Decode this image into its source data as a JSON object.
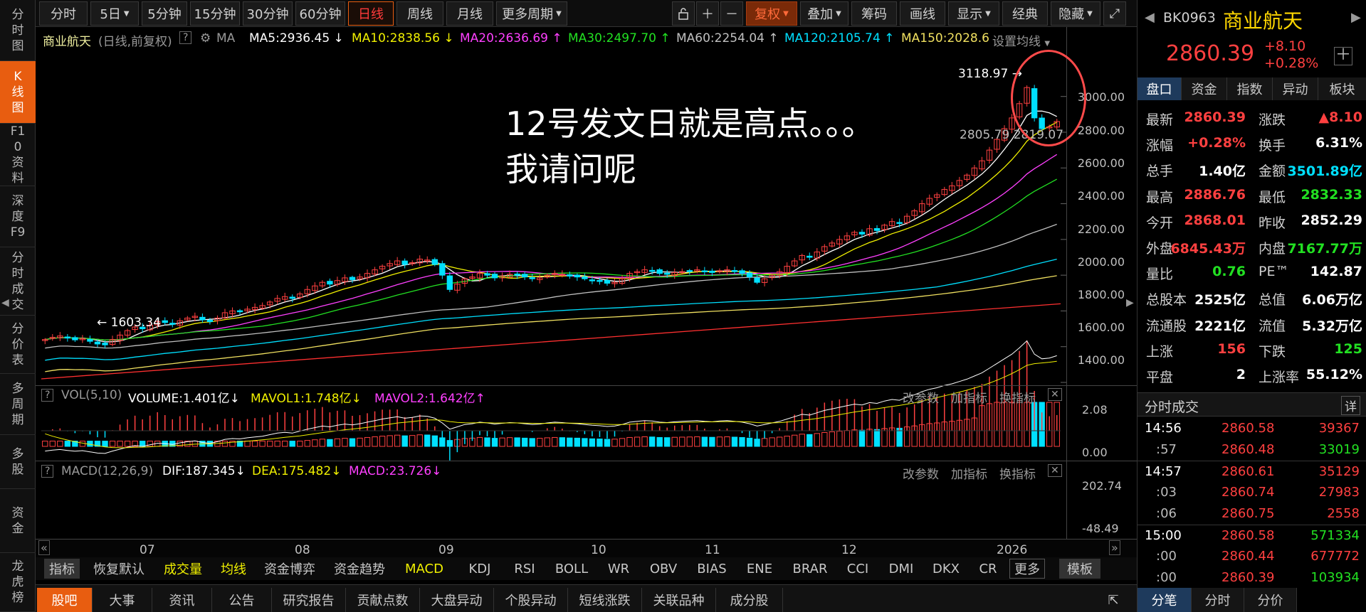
{
  "left_tabs": [
    {
      "label": "分时图",
      "active": false
    },
    {
      "label": "K线图",
      "active": true
    },
    {
      "label": "F10资料",
      "active": false
    },
    {
      "label": "深度F9",
      "active": false
    },
    {
      "label": "分时成交",
      "active": false
    },
    {
      "label": "分价表",
      "active": false
    },
    {
      "label": "多周期",
      "active": false
    },
    {
      "label": "多股",
      "active": false
    },
    {
      "label": "资金",
      "active": false
    },
    {
      "label": "龙虎榜",
      "active": false
    }
  ],
  "toolbar": {
    "periods": [
      "分时",
      "5日",
      "5分钟",
      "15分钟",
      "30分钟",
      "60分钟",
      "日线",
      "周线",
      "月线",
      "更多周期"
    ],
    "active_period": "日线",
    "fuquan": "复权",
    "diejia": "叠加",
    "chouma": "筹码",
    "huaxian": "画线",
    "xianshi": "显示",
    "jingdian": "经典",
    "yincang": "隐藏"
  },
  "ma_bar": {
    "name": "商业航天",
    "mode": "(日线,前复权)",
    "q": "?",
    "ma": "MA",
    "ma5": "MA5:2936.45",
    "ma10": "MA10:2838.56",
    "ma20": "MA20:2636.69",
    "ma30": "MA30:2497.70",
    "ma60": "MA60:2254.04",
    "ma120": "MA120:2105.74",
    "ma150": "MA150:2028.6",
    "settings": "设置均线"
  },
  "price_axis": [
    "3000.00",
    "2800.00",
    "2600.00",
    "2400.00",
    "2200.00",
    "2000.00",
    "1800.00",
    "1600.00",
    "1400.00"
  ],
  "annotations": {
    "high": "3118.97",
    "low": "1603.34",
    "last_left": "2805.79",
    "last_right": "2819.07"
  },
  "overlay_text": {
    "line1": "12号发文日就是高点。。。",
    "line2": "我请问呢"
  },
  "vol": {
    "q": "?",
    "title": "VOL(5,10)",
    "volume": "VOLUME:1.401亿",
    "mavol1": "MAVOL1:1.748亿",
    "mavol2": "MAVOL2:1.642亿",
    "axis_top": "2.08",
    "axis_bottom": "0.00"
  },
  "macd": {
    "q": "?",
    "title": "MACD(12,26,9)",
    "dif": "DIF:187.345",
    "dea": "DEA:175.482",
    "macd": "MACD:23.726",
    "axis_top": "202.74",
    "axis_bottom": "-48.49"
  },
  "panel_buttons": {
    "param": "改参数",
    "add": "加指标",
    "swap": "换指标"
  },
  "x_axis": [
    "07",
    "08",
    "09",
    "10",
    "11",
    "12",
    "2026"
  ],
  "indicator_tabs": [
    "指标",
    "恢复默认",
    "成交量",
    "均线",
    "资金博弈",
    "资金趋势",
    "MACD",
    "KDJ",
    "RSI",
    "BOLL",
    "WR",
    "OBV",
    "BIAS",
    "ENE",
    "BRAR",
    "CCI",
    "DMI",
    "DKX",
    "CR",
    "更多",
    "模板"
  ],
  "bottom_tabs": [
    "股吧",
    "大事",
    "资讯",
    "公告",
    "研究报告",
    "贡献点数",
    "大盘异动",
    "个股异动",
    "短线涨跌",
    "关联品种",
    "成分股"
  ],
  "stock": {
    "code": "BK0963",
    "name": "商业航天",
    "price": "2860.39",
    "change": "+8.10",
    "pct": "+0.28%"
  },
  "right_tabs": [
    "盘口",
    "资金",
    "指数",
    "异动",
    "板块"
  ],
  "quote": [
    {
      "l1": "最新",
      "v1": "2860.39",
      "c1": "red",
      "l2": "涨跌",
      "v2": "▲8.10",
      "c2": "red"
    },
    {
      "l1": "涨幅",
      "v1": "+0.28%",
      "c1": "red",
      "l2": "换手",
      "v2": "6.31%",
      "c2": "white"
    },
    {
      "l1": "总手",
      "v1": "1.40亿",
      "c1": "white",
      "l2": "金额",
      "v2": "3501.89亿",
      "c2": "cyan"
    },
    {
      "l1": "最高",
      "v1": "2886.76",
      "c1": "red",
      "l2": "最低",
      "v2": "2832.33",
      "c2": "green"
    },
    {
      "l1": "今开",
      "v1": "2868.01",
      "c1": "red",
      "l2": "昨收",
      "v2": "2852.29",
      "c2": "white"
    },
    {
      "l1": "外盘",
      "v1": "6845.43万",
      "c1": "red",
      "l2": "内盘",
      "v2": "7167.77万",
      "c2": "green"
    },
    {
      "l1": "量比",
      "v1": "0.76",
      "c1": "green",
      "l2": "PE™",
      "v2": "142.87",
      "c2": "white"
    },
    {
      "l1": "总股本",
      "v1": "2525亿",
      "c1": "white",
      "l2": "总值",
      "v2": "6.06万亿",
      "c2": "white"
    },
    {
      "l1": "流通股",
      "v1": "2221亿",
      "c1": "white",
      "l2": "流值",
      "v2": "5.32万亿",
      "c2": "white"
    },
    {
      "l1": "上涨",
      "v1": "156",
      "c1": "red",
      "l2": "下跌",
      "v2": "125",
      "c2": "green"
    },
    {
      "l1": "平盘",
      "v1": "2",
      "c1": "white",
      "l2": "上涨率",
      "v2": "55.12%",
      "c2": "white"
    }
  ],
  "ticks_title": "分时成交",
  "ticks_detail": "详",
  "ticks": [
    {
      "time": "14:56",
      "price": "2860.58",
      "vol": "39367",
      "vc": "red"
    },
    {
      "time": ":57",
      "price": "2860.48",
      "vol": "33019",
      "vc": "green"
    },
    {
      "time": "14:57",
      "price": "2860.61",
      "vol": "35129",
      "vc": "red"
    },
    {
      "time": ":03",
      "price": "2860.74",
      "vol": "27983",
      "vc": "red"
    },
    {
      "time": ":06",
      "price": "2860.75",
      "vol": "2558",
      "vc": "red"
    },
    {
      "time": "15:00",
      "price": "2860.58",
      "vol": "571334",
      "vc": "green"
    },
    {
      "time": ":00",
      "price": "2860.44",
      "vol": "677772",
      "vc": "red"
    },
    {
      "time": ":00",
      "price": "2860.39",
      "vol": "103934",
      "vc": "green"
    }
  ],
  "right_bottom_tabs": [
    "分笔",
    "分时",
    "分价"
  ],
  "colors": {
    "accent": "#e85d10",
    "up": "#ff4040",
    "down": "#00e0ff",
    "ma5": "#ffffff",
    "ma10": "#f0f000",
    "ma20": "#ff40ff",
    "ma30": "#22e022",
    "ma60": "#c0c0c0",
    "ma120": "#00e0ff",
    "ma150": "#f0e060",
    "ma250": "#ff3030",
    "circle": "#ff4040"
  },
  "chart_data": {
    "type": "candlestick",
    "x_ticks": [
      "07",
      "08",
      "09",
      "10",
      "11",
      "12",
      "2026"
    ],
    "ylim": [
      1400,
      3150
    ],
    "close": [
      1640,
      1652,
      1660,
      1648,
      1638,
      1645,
      1630,
      1615,
      1610,
      1640,
      1665,
      1690,
      1710,
      1700,
      1720,
      1740,
      1735,
      1725,
      1745,
      1760,
      1770,
      1750,
      1740,
      1760,
      1790,
      1800,
      1795,
      1810,
      1820,
      1830,
      1850,
      1870,
      1880,
      1870,
      1895,
      1920,
      1940,
      1960,
      1950,
      1970,
      1985,
      1975,
      1990,
      2010,
      2030,
      2050,
      2065,
      2080,
      2060,
      2070,
      2090,
      2085,
      2060,
      2000,
      1920,
      1950,
      1980,
      1990,
      2010,
      2000,
      1985,
      1995,
      2005,
      2000,
      1990,
      1980,
      1985,
      2000,
      2010,
      2005,
      1995,
      1990,
      1980,
      1970,
      1965,
      1955,
      1960,
      1980,
      2010,
      2020,
      2030,
      2025,
      2010,
      2005,
      2015,
      2020,
      2025,
      2030,
      2020,
      2015,
      2025,
      2030,
      2020,
      2010,
      1990,
      1960,
      1980,
      2000,
      2020,
      2050,
      2080,
      2110,
      2100,
      2130,
      2160,
      2180,
      2200,
      2220,
      2240,
      2230,
      2260,
      2250,
      2280,
      2300,
      2290,
      2330,
      2360,
      2400,
      2430,
      2450,
      2480,
      2500,
      2530,
      2560,
      2600,
      2640,
      2700,
      2760,
      2820,
      2880,
      2960,
      3050,
      2880,
      2820,
      2830,
      2860
    ],
    "ma_values": {
      "MA5": 2936.45,
      "MA10": 2838.56,
      "MA20": 2636.69,
      "MA30": 2497.7,
      "MA60": 2254.04,
      "MA120": 2105.74,
      "MA150": 2028.6
    },
    "volume_axis": [
      0.0,
      2.08
    ],
    "macd_axis": [
      -48.49,
      202.74
    ],
    "high": 3118.97,
    "low": 1603.34
  }
}
